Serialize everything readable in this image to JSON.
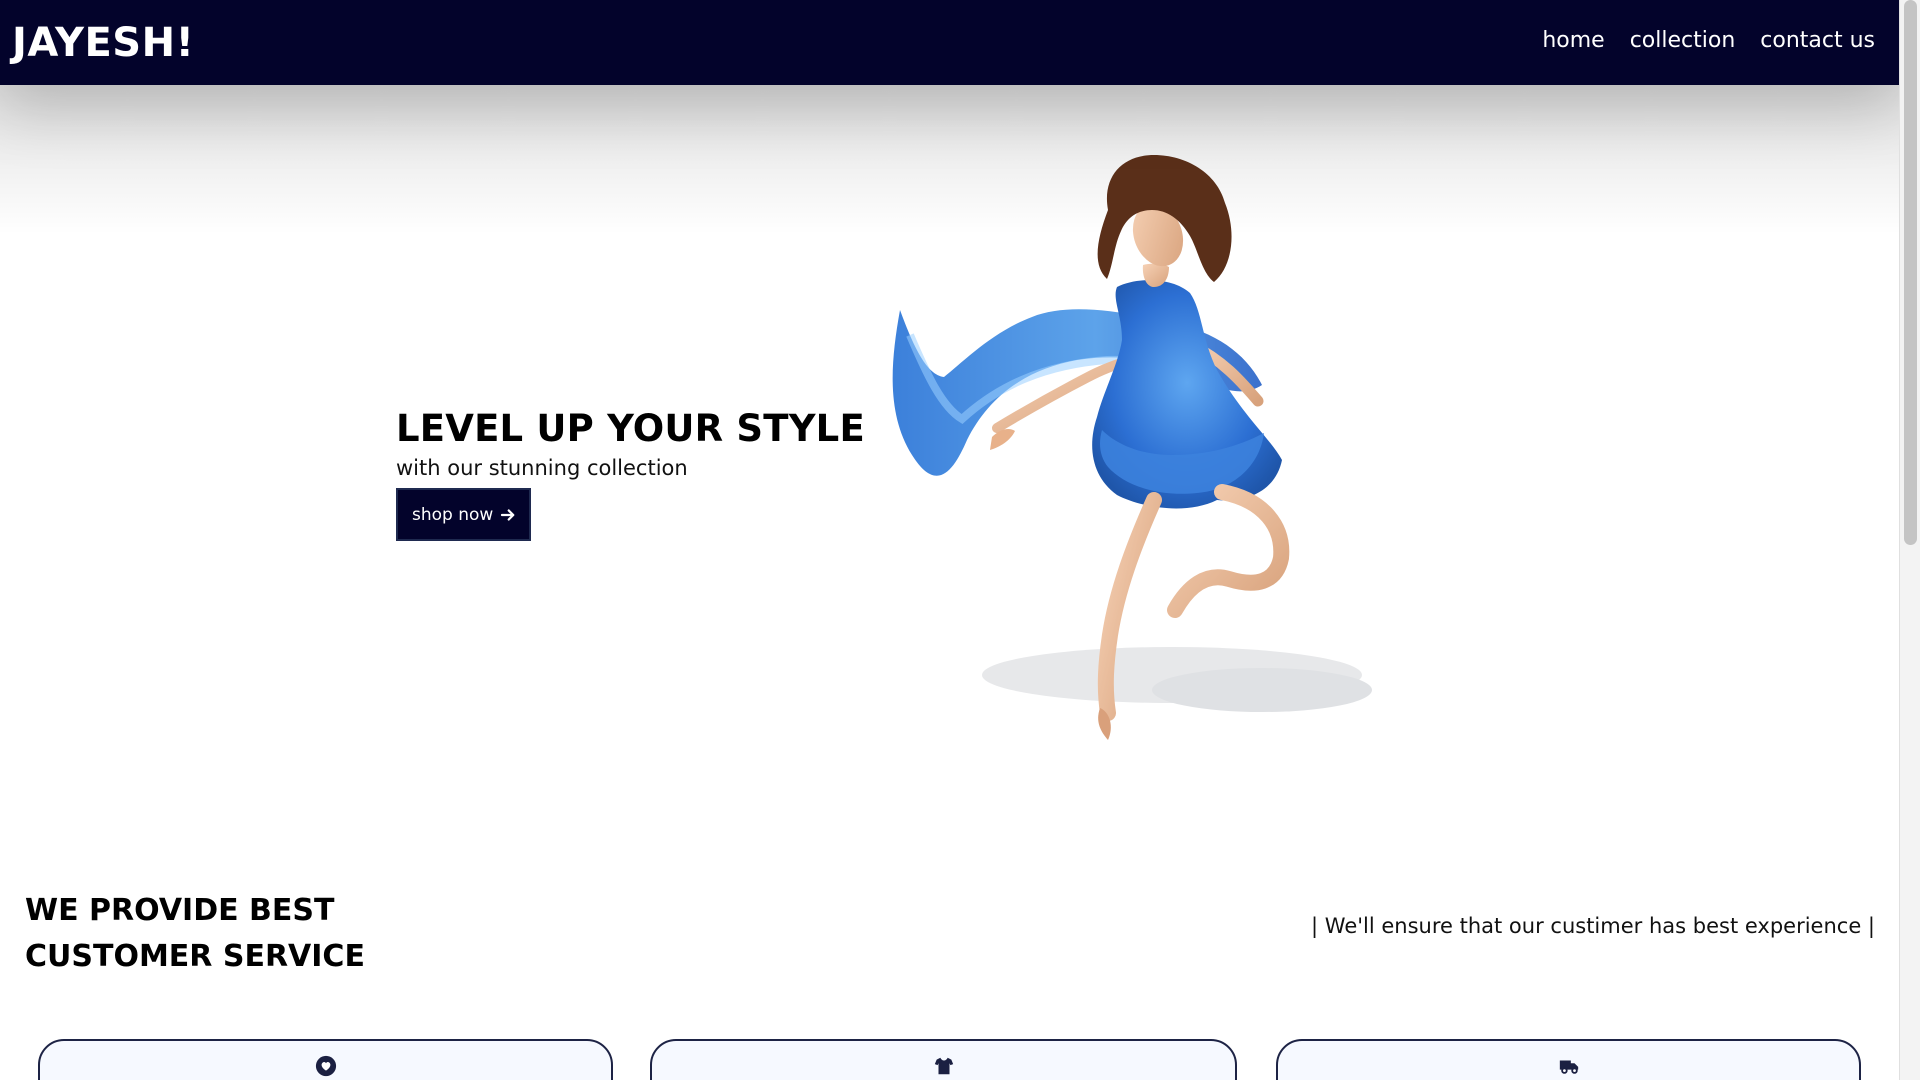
{
  "navbar": {
    "brand": "JAYESH!",
    "links": [
      "home",
      "collection",
      "contact us"
    ]
  },
  "hero": {
    "title": "LEVEL UP YOUR STYLE",
    "subtitle": "with our stunning collection",
    "button_label": "shop now",
    "image_icon": "dancer-in-blue-dress-image"
  },
  "services": {
    "title_line_1": "WE PROVIDE BEST",
    "title_line_2": "CUSTOMER SERVICE",
    "tagline": "| We'll ensure that our custimer has best experience |",
    "cards": [
      {
        "icon": "heart-icon"
      },
      {
        "icon": "tshirt-icon"
      },
      {
        "icon": "truck-icon"
      }
    ]
  },
  "colors": {
    "navbar_bg": "#03032b",
    "button_bg": "#03032b",
    "card_border": "#1d2345",
    "card_bg": "#f6f9ff",
    "dress_blue": "#2f6fd1"
  }
}
